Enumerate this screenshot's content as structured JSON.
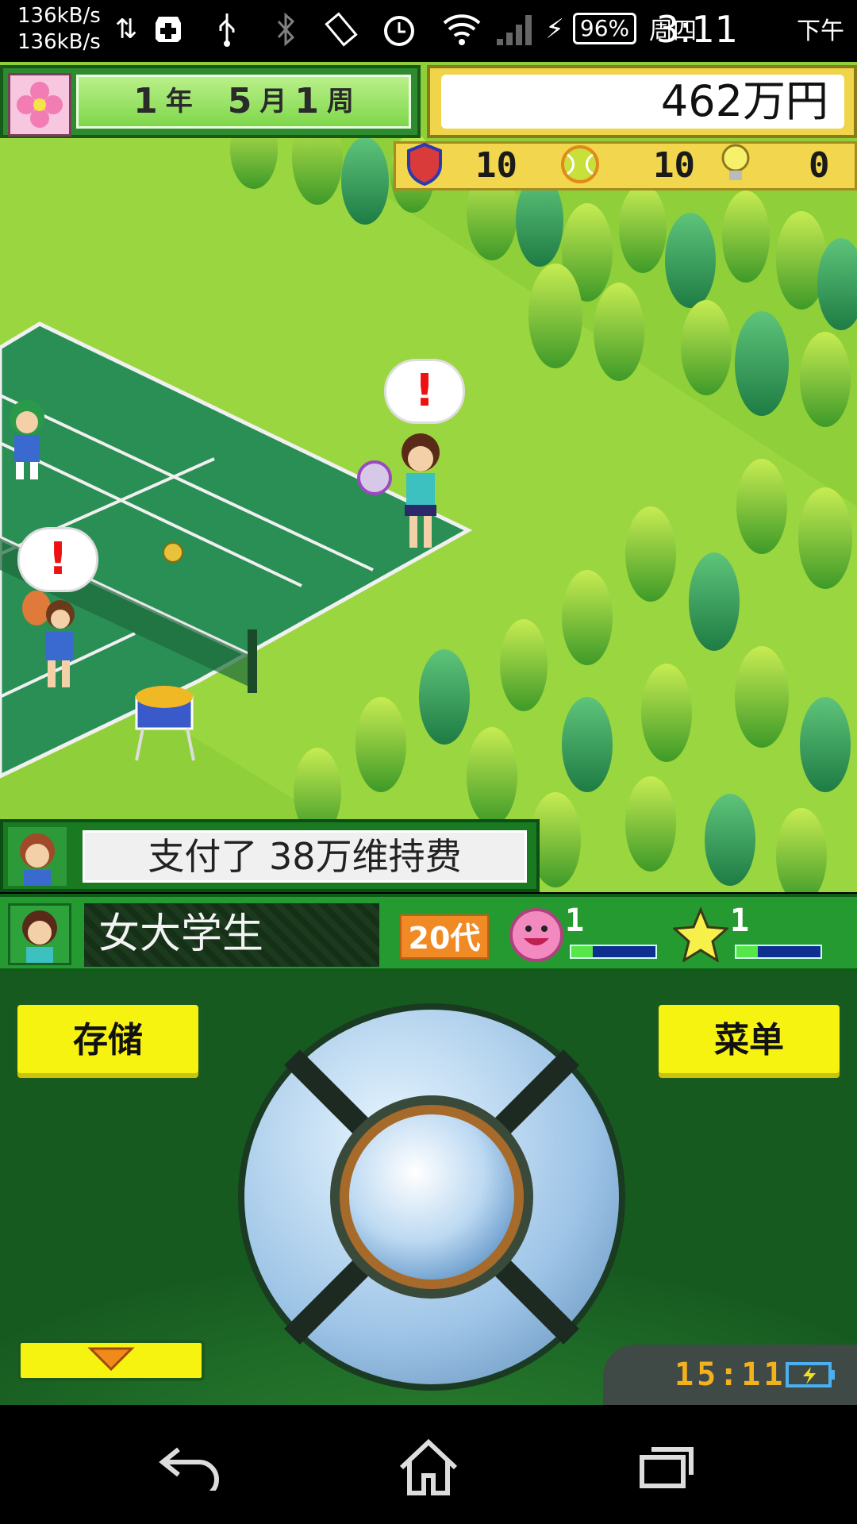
{
  "status_bar": {
    "net_speed_up": "136kB/s",
    "net_speed_down": "136kB/s",
    "battery_percent": "96%",
    "day": "周四",
    "time": "3:11",
    "ampm": "下午",
    "icons": [
      "data-arrows-icon",
      "medical-plus-icon",
      "usb-icon",
      "bluetooth-icon",
      "rotate-icon",
      "alarm-icon",
      "wifi-icon",
      "signal-icon",
      "charging-icon"
    ]
  },
  "hud": {
    "year_num": "1",
    "year_label": "年",
    "month_num": "5",
    "month_label": "月",
    "week_num": "1",
    "week_label": "周",
    "money": "462万円",
    "stats": [
      {
        "icon": "badge-icon",
        "value": "10"
      },
      {
        "icon": "tennis-ball-icon",
        "value": "10"
      },
      {
        "icon": "lightbulb-icon",
        "value": "0"
      }
    ]
  },
  "message": {
    "text": "支付了 38万维持费"
  },
  "character": {
    "name": "女大学生",
    "age": "20代",
    "stat1_value": "1",
    "stat1_fill": 0.25,
    "stat2_value": "1",
    "stat2_fill": 0.25
  },
  "controls": {
    "save_label": "存储",
    "menu_label": "菜单",
    "clock": "15:11"
  },
  "colors": {
    "grass": "#8fcf3a",
    "court": "#2a8f54",
    "panel_green": "#249a30",
    "button_yellow": "#f7f311"
  }
}
